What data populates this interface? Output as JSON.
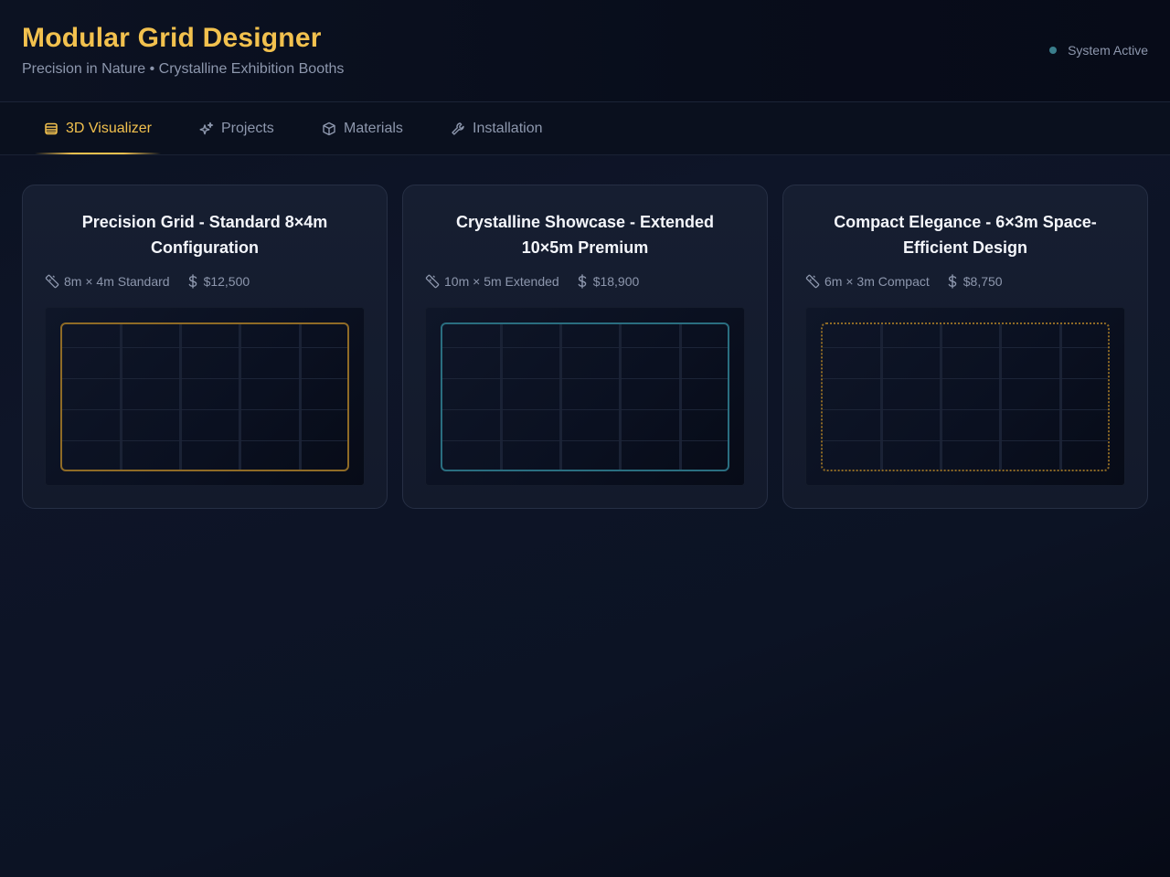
{
  "header": {
    "title": "Modular Grid Designer",
    "subtitle": "Precision in Nature • Crystalline Exhibition Booths",
    "status": "System Active"
  },
  "tabs": [
    {
      "label": "3D Visualizer",
      "icon": "layers-icon",
      "active": true
    },
    {
      "label": "Projects",
      "icon": "sparkles-icon",
      "active": false
    },
    {
      "label": "Materials",
      "icon": "cube-icon",
      "active": false
    },
    {
      "label": "Installation",
      "icon": "wrench-icon",
      "active": false
    }
  ],
  "cards": [
    {
      "title": "Precision Grid - Standard 8×4m Configuration",
      "size": "8m × 4m Standard",
      "price": "$12,500",
      "frame_color": "#8f6b26"
    },
    {
      "title": "Crystalline Showcase - Extended 10×5m Premium",
      "size": "10m × 5m Extended",
      "price": "$18,900",
      "frame_color": "#2a6e80"
    },
    {
      "title": "Compact Elegance - 6×3m Space-Efficient Design",
      "size": "6m × 3m Compact",
      "price": "$8,750",
      "frame_color": "#8f6b26"
    }
  ],
  "colors": {
    "accent": "#f2c14e",
    "teal": "#3a7e8c",
    "muted_text": "#8d97ad",
    "background": "#0b1120"
  }
}
